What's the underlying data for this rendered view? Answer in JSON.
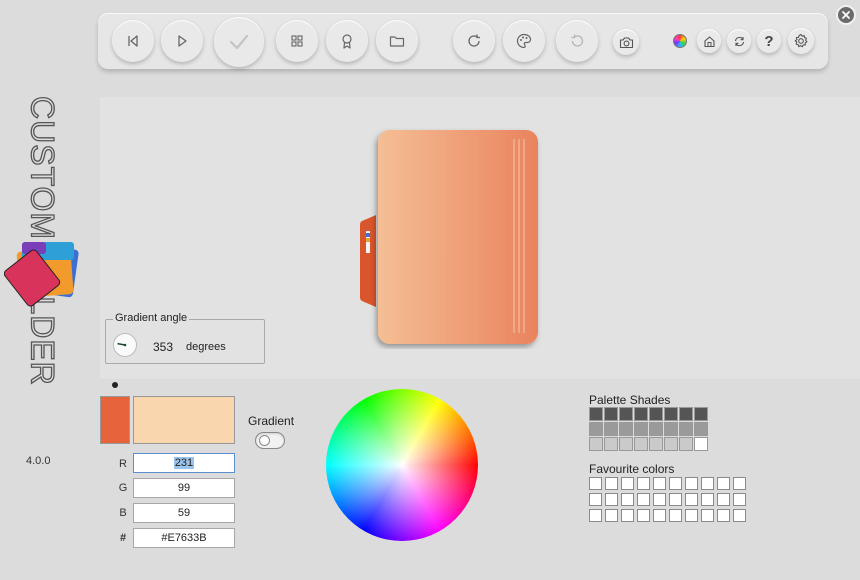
{
  "app": {
    "name": "CUSTOM FOLDER",
    "version": "4.0.0"
  },
  "toolbar": {
    "buttons": [
      {
        "name": "previous-button",
        "icon": "skip-previous-icon"
      },
      {
        "name": "play-button",
        "icon": "play-icon"
      },
      {
        "name": "apply-button",
        "icon": "checkmark-icon"
      },
      {
        "name": "grid-button",
        "icon": "grid-icon"
      },
      {
        "name": "award-button",
        "icon": "badge-icon"
      },
      {
        "name": "folder-button",
        "icon": "folder-icon"
      },
      {
        "name": "refresh-button",
        "icon": "refresh-icon"
      },
      {
        "name": "palette-button",
        "icon": "palette-icon"
      },
      {
        "name": "undo-button",
        "icon": "undo-icon"
      },
      {
        "name": "screenshot-button",
        "icon": "camera-icon"
      },
      {
        "name": "color-mode-button",
        "icon": "color-wheel-icon"
      },
      {
        "name": "home-button",
        "icon": "home-icon"
      },
      {
        "name": "sync-button",
        "icon": "sync-icon"
      },
      {
        "name": "help-button",
        "icon": "question-icon"
      },
      {
        "name": "settings-button",
        "icon": "gear-icon"
      }
    ]
  },
  "gradient_angle": {
    "label": "Gradient angle",
    "value": "353",
    "unit": "degrees"
  },
  "colors": {
    "primary": "#E7633B",
    "secondary": "#F9D6AE",
    "folder_light": "#F5BE94",
    "folder_dark": "#E9835E",
    "folder_back": "#D9562C"
  },
  "rgb": {
    "r_label": "R",
    "g_label": "G",
    "b_label": "B",
    "hex_label": "#",
    "r": "231",
    "g": "99",
    "b": "59",
    "hex": "#E7633B"
  },
  "gradient": {
    "label": "Gradient",
    "enabled": false
  },
  "palette": {
    "shades_title": "Palette Shades",
    "favourites_title": "Favourite colors",
    "shades": [
      "#555555",
      "#555555",
      "#555555",
      "#555555",
      "#555555",
      "#555555",
      "#555555",
      "#555555",
      "#9a9a9a",
      "#9a9a9a",
      "#9a9a9a",
      "#9a9a9a",
      "#9a9a9a",
      "#9a9a9a",
      "#9a9a9a",
      "#9a9a9a",
      "#cacaca",
      "#cacaca",
      "#cacaca",
      "#cacaca",
      "#cacaca",
      "#cacaca",
      "#cacaca",
      "#ffffff"
    ]
  }
}
